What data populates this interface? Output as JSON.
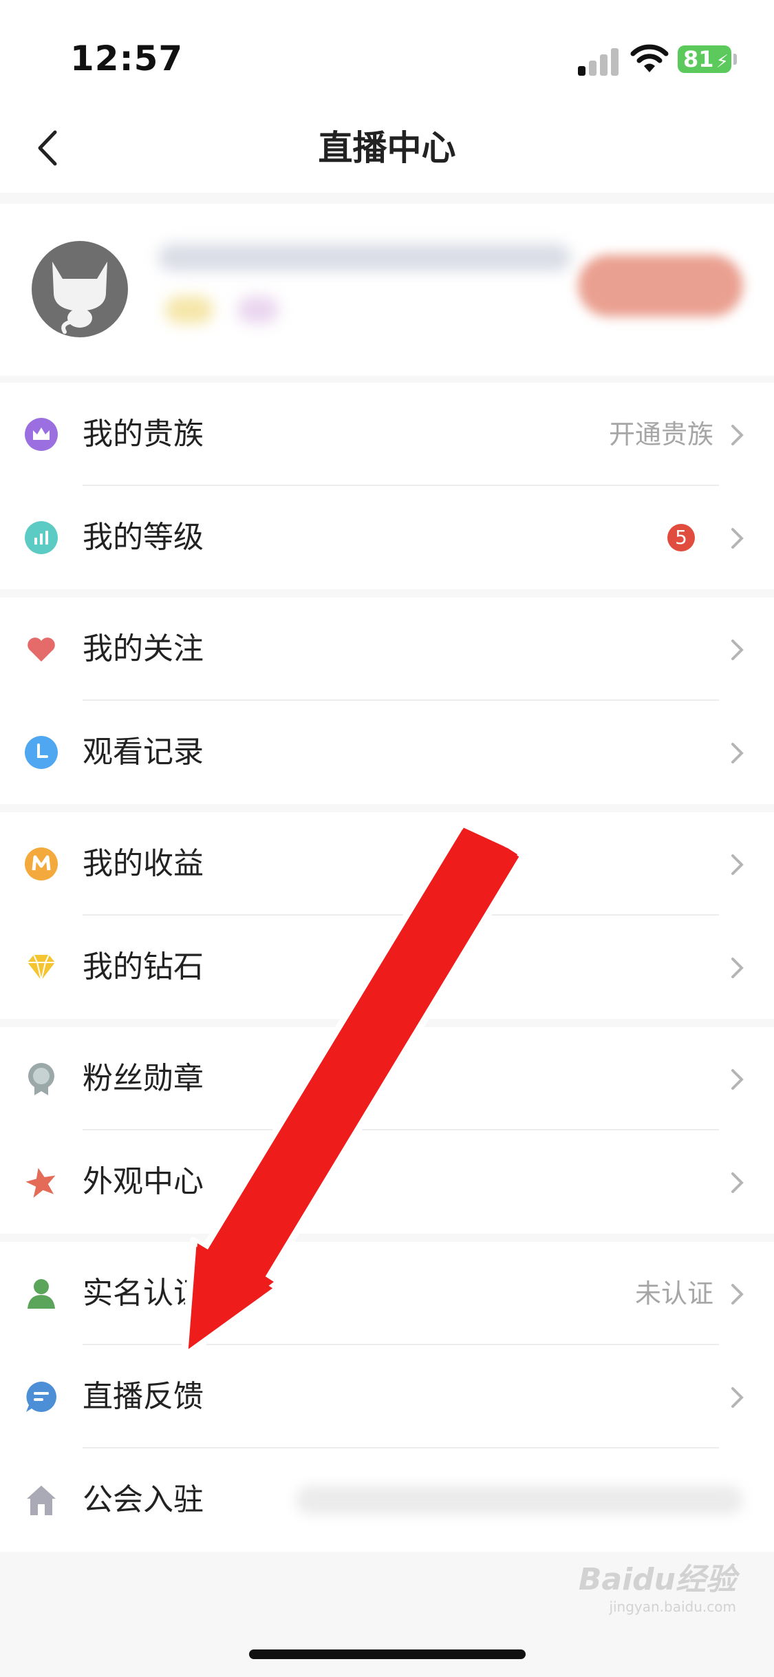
{
  "status_bar": {
    "time": "12:57",
    "battery": "81"
  },
  "nav": {
    "title": "直播中心",
    "back_icon": "chevron-left-icon"
  },
  "menu": {
    "noble": {
      "label": "我的贵族",
      "right_text": "开通贵族",
      "icon": "crown-icon",
      "color": "#9b6fe0"
    },
    "level": {
      "label": "我的等级",
      "badge": "5",
      "icon": "level-bars-icon",
      "color": "#5ccbc4"
    },
    "follows": {
      "label": "我的关注",
      "icon": "heart-icon",
      "color": "#e56b6b"
    },
    "history": {
      "label": "观看记录",
      "icon": "clock-icon",
      "color": "#4ea7f0"
    },
    "earnings": {
      "label": "我的收益",
      "icon": "coin-m-icon",
      "color": "#f3a93b"
    },
    "diamonds": {
      "label": "我的钻石",
      "icon": "diamond-icon",
      "color": "#f5c531"
    },
    "fan_badge": {
      "label": "粉丝勋章",
      "icon": "medal-icon",
      "color": "#9aa8a8"
    },
    "appearance": {
      "label": "外观中心",
      "icon": "star-icon",
      "color": "#e36b58"
    },
    "verify": {
      "label": "实名认证",
      "right_text": "未认证",
      "icon": "person-icon",
      "color": "#5aa55a"
    },
    "feedback": {
      "label": "直播反馈",
      "icon": "chat-bubble-icon",
      "color": "#4c8fd6"
    },
    "guild": {
      "label": "公会入驻",
      "icon": "house-icon",
      "color": "#a9aab5"
    }
  },
  "watermark": {
    "brand": "Baidu经验",
    "site": "jingyan.baidu.com"
  }
}
